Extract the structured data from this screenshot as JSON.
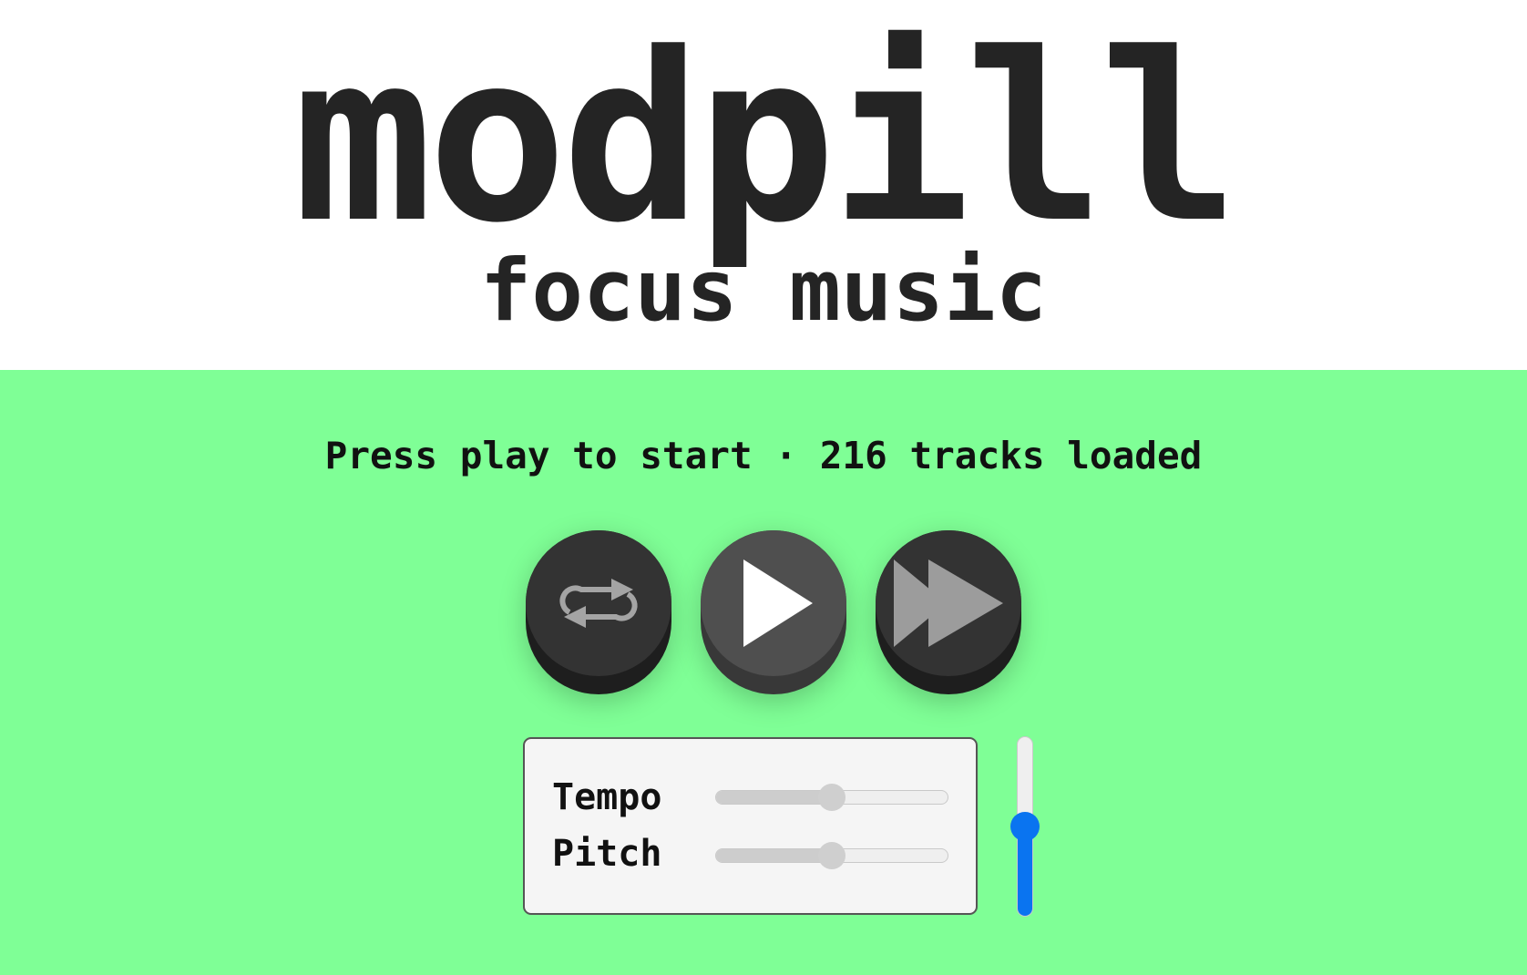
{
  "header": {
    "title": "modpill",
    "subtitle": "focus music"
  },
  "status": {
    "text": "Press play to start · 216 tracks loaded"
  },
  "controls": {
    "repeat": {
      "icon": "repeat-icon"
    },
    "play": {
      "icon": "play-icon"
    },
    "next": {
      "icon": "fast-forward-icon"
    }
  },
  "panel": {
    "tempo_label": "Tempo",
    "tempo_value": 0.5,
    "pitch_label": "Pitch",
    "pitch_value": 0.5
  },
  "volume": {
    "value": 0.5
  },
  "colors": {
    "background": "#7fff96",
    "header": "#ffffff",
    "button": "#333333",
    "accent": "#0a74f0"
  }
}
